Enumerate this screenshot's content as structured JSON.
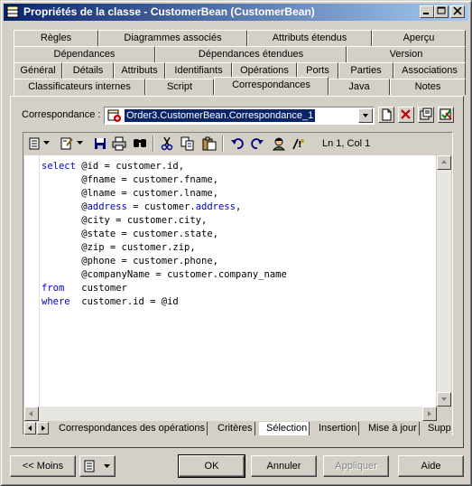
{
  "window": {
    "title": "Propriétés de la classe - CustomerBean (CustomerBean)",
    "controls": {
      "minimize": "_",
      "maximize": "□",
      "close": "×"
    }
  },
  "tabs": {
    "row1": [
      "Règles",
      "Diagrammes associés",
      "Attributs étendus",
      "Aperçu"
    ],
    "row2": [
      "Dépendances",
      "Dépendances étendues",
      "Version"
    ],
    "row3": [
      "Général",
      "Détails",
      "Attributs",
      "Identifiants",
      "Opérations",
      "Ports",
      "Parties",
      "Associations"
    ],
    "row4": [
      "Classificateurs internes",
      "Script",
      "Correspondances",
      "Java",
      "Notes"
    ],
    "active": "Correspondances"
  },
  "mapping": {
    "label": "Correspondance :",
    "value": "Order3.CustomerBean.Correspondance_1"
  },
  "toolbar": {
    "position": "Ln 1, Col 1"
  },
  "editor": {
    "lines": [
      {
        "kw": "select",
        "text": " @id = customer.id,"
      },
      {
        "kw": "",
        "text": "       @fname = customer.fname,"
      },
      {
        "kw": "",
        "text": "       @lname = customer.lname,"
      },
      {
        "kw": "",
        "text": "       @",
        "kw2": "address",
        "text2": " = customer.",
        "kw3": "address",
        "text3": ","
      },
      {
        "kw": "",
        "text": "       @city = customer.city,"
      },
      {
        "kw": "",
        "text": "       @state = customer.state,"
      },
      {
        "kw": "",
        "text": "       @zip = customer.zip,"
      },
      {
        "kw": "",
        "text": "       @phone = customer.phone,"
      },
      {
        "kw": "",
        "text": "       @companyName = customer.company_name"
      },
      {
        "kw": "from",
        "text": "   customer"
      },
      {
        "kw": "where",
        "text": "  customer.id = @id"
      }
    ]
  },
  "bottom_tabs": [
    "Correspondances des opérations",
    "Critères",
    "Sélection",
    "Insertion",
    "Mise à jour",
    "Supp"
  ],
  "bottom_tabs_active": "Sélection",
  "buttons": {
    "less": "<< Moins",
    "ok": "OK",
    "cancel": "Annuler",
    "apply": "Appliquer",
    "help": "Aide"
  },
  "colors": {
    "title_start": "#0a246a",
    "title_end": "#a6caf0",
    "keyword": "#0000c0",
    "face": "#d4d0c8"
  }
}
